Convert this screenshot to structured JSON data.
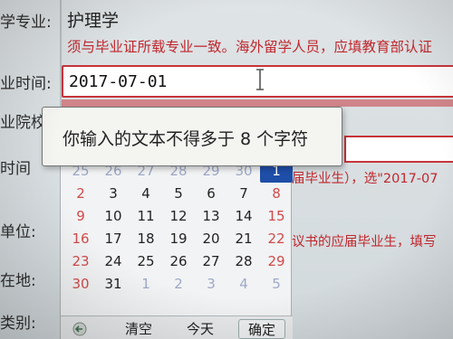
{
  "labels": {
    "major": "学专业:",
    "grad_time": "业时间:",
    "grad_school": "业院校",
    "time": "时间",
    "unit": "单位:",
    "location": "在地:",
    "category": "类别:"
  },
  "fields": {
    "major_value": "护理学",
    "major_note": "须与毕业证所载专业一致。海外留学人员，应填教育部认证",
    "grad_date": "2017-07-01",
    "side_note_1": "届毕业生），选\"2017-07",
    "side_note_2": "议书的应届毕业生，填写"
  },
  "tooltip": {
    "text": "你输入的文本不得多于 8 个字符"
  },
  "calendar": {
    "rows": [
      [
        "25",
        "26",
        "27",
        "28",
        "29",
        "30",
        "1"
      ],
      [
        "2",
        "3",
        "4",
        "5",
        "6",
        "7",
        "8"
      ],
      [
        "9",
        "10",
        "11",
        "12",
        "13",
        "14",
        "15"
      ],
      [
        "16",
        "17",
        "18",
        "19",
        "20",
        "21",
        "22"
      ],
      [
        "23",
        "24",
        "25",
        "26",
        "27",
        "28",
        "29"
      ],
      [
        "30",
        "31",
        "1",
        "2",
        "3",
        "4",
        "5"
      ]
    ],
    "clear_label": "清空",
    "today_label": "今天",
    "ok_label": "确定",
    "selected_color": "#1f4ea8",
    "weekend_color": "#d04a4a"
  },
  "icons": {
    "text_cursor": "text-cursor-icon",
    "back": "back-arrow-icon"
  },
  "colors": {
    "error_red": "#c8343a",
    "note_red": "#c0272d"
  }
}
